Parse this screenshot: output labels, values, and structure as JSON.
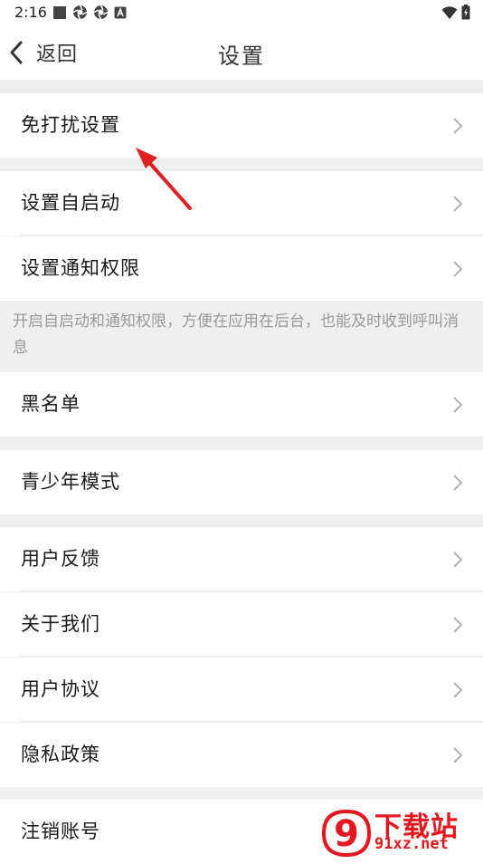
{
  "status_bar": {
    "time": "2:16",
    "icons": [
      "square-app-icon",
      "aperture-icon",
      "aperture-icon",
      "letter-a-icon"
    ],
    "right_icons": [
      "wifi-icon",
      "battery-charging-icon"
    ]
  },
  "header": {
    "back_label": "返回",
    "title": "设置"
  },
  "rows": [
    {
      "label": "免打扰设置"
    },
    {
      "label": "设置自启动"
    },
    {
      "label": "设置通知权限"
    },
    {
      "label": "黑名单"
    },
    {
      "label": "青少年模式"
    },
    {
      "label": "用户反馈"
    },
    {
      "label": "关于我们"
    },
    {
      "label": "用户协议"
    },
    {
      "label": "隐私政策"
    },
    {
      "label": "注销账号"
    }
  ],
  "note": "开启自启动和通知权限，方便在应用在后台，也能及时收到呼叫消息",
  "annotation": {
    "arrow_color": "#e02020"
  },
  "watermark": {
    "main": "下载站",
    "url": "91xz.net",
    "logo_text": "9",
    "color": "#e3171d"
  }
}
